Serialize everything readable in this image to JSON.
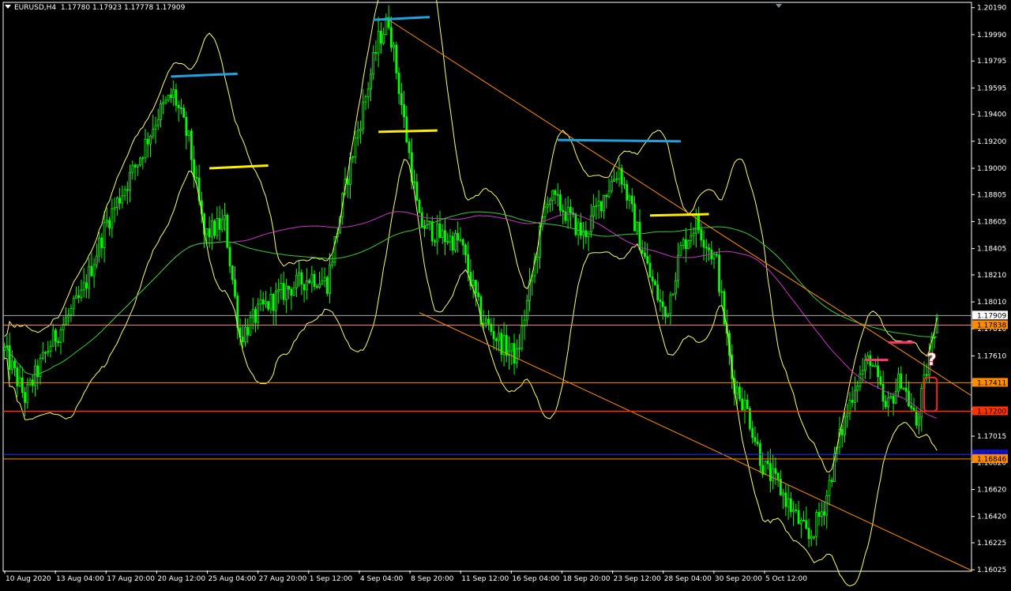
{
  "header": {
    "symbol": "EURUSD,H4",
    "ohlc": "1.17780 1.17923 1.17778 1.17909",
    "menu_icon": "triangle-down-icon"
  },
  "colors": {
    "background": "#000000",
    "axis": "#ffffff",
    "bull_candle": "#00ff00",
    "bear_candle": "#00ff00",
    "bollinger": "#ffff66",
    "ma_fast": "#cc33cc",
    "ma_slow": "#33cc33",
    "channel": "#ff8c00",
    "resistance_blue": "#1fa3e0",
    "resistance_yellow": "#ffee00",
    "marker_pink": "#ff3366",
    "level_orange": "#ff8c00",
    "level_red": "#ff3300",
    "level_blue": "#2233ff",
    "bid_line": "#aaaaaa",
    "label_orange_bg": "#ff8c00",
    "label_red_bg": "#ff3300",
    "label_white_bg": "#ffffff",
    "label_blue_bg": "#1111cc"
  },
  "chart_data": {
    "type": "line",
    "symbol": "EURUSD",
    "timeframe": "H4",
    "ylim": [
      1.1602,
      1.202
    ],
    "price_ticks": [
      "1.20190",
      "1.19990",
      "1.19795",
      "1.19595",
      "1.19400",
      "1.19200",
      "1.19000",
      "1.18805",
      "1.18605",
      "1.18405",
      "1.18210",
      "1.18010",
      "1.17810",
      "1.17610",
      "1.17415",
      "1.17215",
      "1.17015",
      "1.16820",
      "1.16620",
      "1.16420",
      "1.16225",
      "1.16025"
    ],
    "time_ticks": [
      "10 Aug 2020",
      "13 Aug 04:00",
      "17 Aug 20:00",
      "20 Aug 12:00",
      "25 Aug 04:00",
      "27 Aug 20:00",
      "1 Sep 12:00",
      "4 Sep 04:00",
      "8 Sep 20:00",
      "11 Sep 12:00",
      "16 Sep 04:00",
      "18 Sep 20:00",
      "23 Sep 12:00",
      "28 Sep 04:00",
      "30 Sep 20:00",
      "5 Oct 12:00"
    ],
    "bars": 301,
    "price_path": [
      [
        0,
        1.1765
      ],
      [
        8,
        1.173
      ],
      [
        18,
        1.177
      ],
      [
        30,
        1.1805
      ],
      [
        40,
        1.186
      ],
      [
        52,
        1.1905
      ],
      [
        60,
        1.194
      ],
      [
        66,
        1.1955
      ],
      [
        72,
        1.192
      ],
      [
        78,
        1.185
      ],
      [
        86,
        1.186
      ],
      [
        92,
        1.1775
      ],
      [
        100,
        1.1795
      ],
      [
        110,
        1.181
      ],
      [
        120,
        1.182
      ],
      [
        126,
        1.1815
      ],
      [
        134,
        1.1895
      ],
      [
        140,
        1.1945
      ],
      [
        146,
        1.1995
      ],
      [
        150,
        1.201
      ],
      [
        156,
        1.1935
      ],
      [
        162,
        1.186
      ],
      [
        170,
        1.185
      ],
      [
        178,
        1.1845
      ],
      [
        186,
        1.179
      ],
      [
        194,
        1.177
      ],
      [
        200,
        1.176
      ],
      [
        206,
        1.182
      ],
      [
        212,
        1.188
      ],
      [
        218,
        1.187
      ],
      [
        226,
        1.185
      ],
      [
        234,
        1.188
      ],
      [
        240,
        1.19
      ],
      [
        246,
        1.186
      ],
      [
        252,
        1.182
      ],
      [
        258,
        1.179
      ],
      [
        264,
        1.184
      ],
      [
        270,
        1.186
      ],
      [
        278,
        1.183
      ],
      [
        284,
        1.1745
      ],
      [
        290,
        1.172
      ],
      [
        296,
        1.168
      ],
      [
        302,
        1.1665
      ],
      [
        308,
        1.1645
      ],
      [
        314,
        1.1625
      ],
      [
        320,
        1.165
      ],
      [
        326,
        1.17
      ],
      [
        332,
        1.174
      ],
      [
        338,
        1.176
      ],
      [
        344,
        1.172
      ],
      [
        350,
        1.1745
      ],
      [
        356,
        1.171
      ],
      [
        362,
        1.177
      ],
      [
        364,
        1.1791
      ]
    ],
    "last_bar": {
      "open": 1.1778,
      "high": 1.17923,
      "low": 1.17778,
      "close": 1.17909
    },
    "horizontal_levels": [
      {
        "price": 1.17909,
        "label": "1.17909",
        "style": "bid"
      },
      {
        "price": 1.17838,
        "label": "1.17838",
        "style": "orange"
      },
      {
        "price": 1.17411,
        "label": "1.17411",
        "style": "orange"
      },
      {
        "price": 1.172,
        "label": "1.17200",
        "style": "red"
      },
      {
        "price": 1.1688,
        "label": "1.16880",
        "style": "blue"
      },
      {
        "price": 1.16846,
        "label": "1.16846",
        "style": "orange"
      }
    ],
    "channel_lines": [
      {
        "from": [
          150,
          1.201
        ],
        "to": [
          364,
          1.1748
        ]
      },
      {
        "from": [
          162,
          1.1793
        ],
        "to": [
          325,
          1.16
        ]
      }
    ],
    "annotations": {
      "blue_segments": [
        {
          "x1": 65,
          "x2": 91,
          "y1": 1.1968,
          "y2": 1.197
        },
        {
          "x1": 144,
          "x2": 166,
          "y1": 1.201,
          "y2": 1.2012
        },
        {
          "x1": 216,
          "x2": 264,
          "y1": 1.1921,
          "y2": 1.192
        }
      ],
      "yellow_segments": [
        {
          "x1": 80,
          "x2": 103,
          "y1": 1.19,
          "y2": 1.1902
        },
        {
          "x1": 146,
          "x2": 169,
          "y1": 1.1927,
          "y2": 1.1928
        },
        {
          "x1": 252,
          "x2": 275,
          "y1": 1.1865,
          "y2": 1.1866
        }
      ],
      "pink_segments": [
        {
          "x1": 336,
          "x2": 345,
          "y1": 1.1758,
          "y2": 1.1758
        },
        {
          "x1": 345,
          "x2": 355,
          "y1": 1.1771,
          "y2": 1.1771
        }
      ],
      "question_mark": {
        "x": 362,
        "price": 1.1759,
        "text": "?"
      },
      "red_box": {
        "x1": 359,
        "x2": 364,
        "top": 1.1745,
        "bottom": 1.172
      }
    }
  }
}
